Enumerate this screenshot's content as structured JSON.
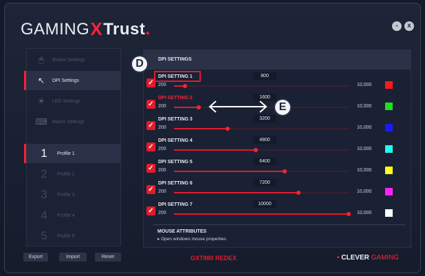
{
  "brand": {
    "gaming": "GAMING",
    "x": "X",
    "trust": "Trust",
    "dot": "."
  },
  "window": {
    "minimize": "-",
    "close": "x"
  },
  "sidebar": {
    "items": [
      {
        "label": "Button Settings",
        "icon": "mouse-icon"
      },
      {
        "label": "DPI Settings",
        "icon": "cursor-icon"
      },
      {
        "label": "LED Settings",
        "icon": "light-icon"
      },
      {
        "label": "Macro Settings",
        "icon": "macro-icon"
      }
    ],
    "profiles": [
      {
        "num": "1",
        "label": "Profile 1"
      },
      {
        "num": "2",
        "label": "Profile 2"
      },
      {
        "num": "3",
        "label": "Profile 3"
      },
      {
        "num": "4",
        "label": "Profile 4"
      },
      {
        "num": "5",
        "label": "Profile 5"
      }
    ]
  },
  "buttons": {
    "export": "Export",
    "import": "Import",
    "reset": "Reset"
  },
  "dpi": {
    "header": "DPI SETTINGS",
    "min_label": "200",
    "max_label": "10,000",
    "min": 200,
    "max": 10000,
    "settings": [
      {
        "name": "DPI SETTING 1",
        "value": "800",
        "level": 800,
        "color": "#ff1a1a",
        "checked": true
      },
      {
        "name": "DPI SETTING 2",
        "value": "1600",
        "level": 1600,
        "color": "#22dd22",
        "checked": true
      },
      {
        "name": "DPI SETTING 3",
        "value": "3200",
        "level": 3200,
        "color": "#1a1aff",
        "checked": true
      },
      {
        "name": "DPI SETTING 4",
        "value": "4800",
        "level": 4800,
        "color": "#22ffee",
        "checked": true
      },
      {
        "name": "DPI SETTING 5",
        "value": "6400",
        "level": 6400,
        "color": "#ffff1a",
        "checked": true
      },
      {
        "name": "DPI SETTING 6",
        "value": "7200",
        "level": 7200,
        "color": "#ff22ff",
        "checked": true
      },
      {
        "name": "DPI SETTING 7",
        "value": "10000",
        "level": 10000,
        "color": "#ffffff",
        "checked": true
      }
    ]
  },
  "attributes": {
    "title": "MOUSE ATTRIBUTES",
    "link": "▸ Open windows mouse properties"
  },
  "callouts": {
    "d": "D",
    "e": "E"
  },
  "footer": {
    "model": "GXT980 REDEX",
    "clever_dot": "•",
    "clever": "CLEVER",
    "gaming": "GAMING"
  },
  "colors": {
    "accent": "#e21b2b",
    "background": "#161c2c",
    "panel": "#1b2134"
  }
}
